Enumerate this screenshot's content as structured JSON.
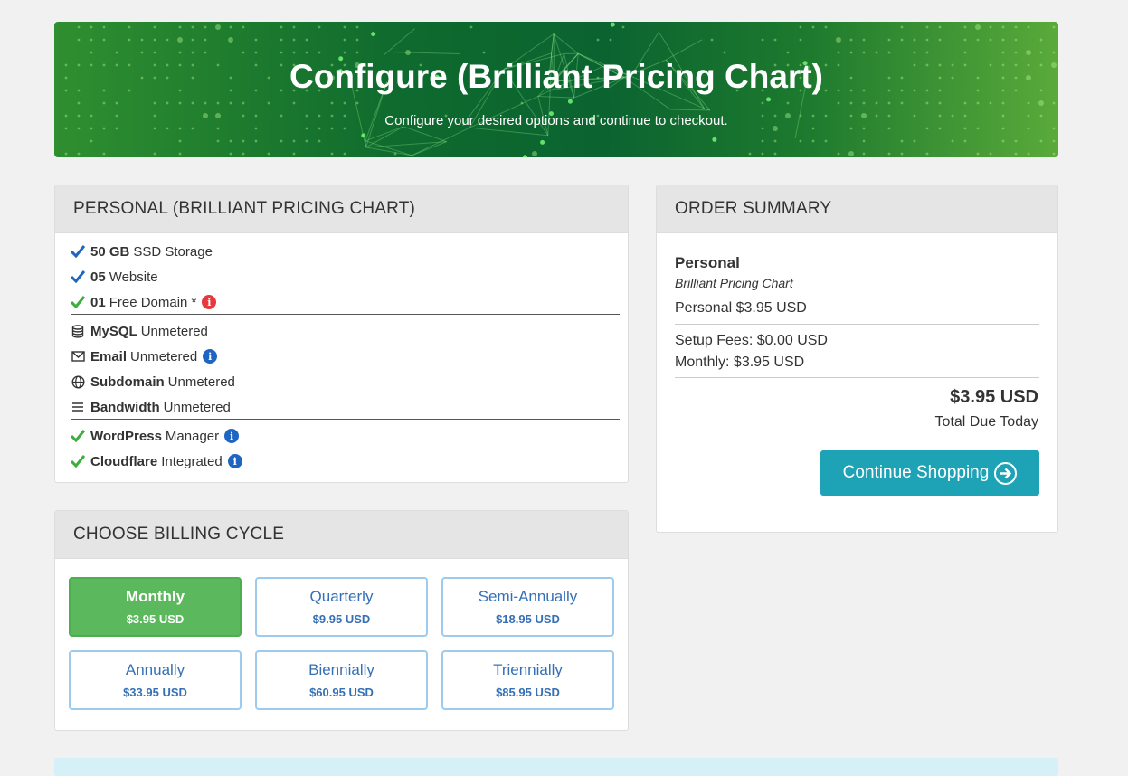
{
  "hero": {
    "title": "Configure (Brilliant Pricing Chart)",
    "subtitle": "Configure your desired options and continue to checkout."
  },
  "product_panel": {
    "title": "PERSONAL (BRILLIANT PRICING CHART)",
    "features": [
      {
        "bold": "50 GB",
        "text": "SSD Storage",
        "icon": "check-icon",
        "color": "#1e66c1"
      },
      {
        "bold": "05",
        "text": "Website",
        "icon": "check-icon",
        "color": "#1e66c1"
      },
      {
        "bold": "01",
        "text": "Free Domain *",
        "icon": "check-icon",
        "color": "#3cae3c",
        "info": "red-info-icon"
      },
      {
        "bold": "MySQL",
        "text": "Unmetered",
        "icon": "database-icon"
      },
      {
        "bold": "Email",
        "text": "Unmetered",
        "icon": "envelope-icon",
        "info": "info-icon"
      },
      {
        "bold": "Subdomain",
        "text": "Unmetered",
        "icon": "globe-icon"
      },
      {
        "bold": "Bandwidth",
        "text": "Unmetered",
        "icon": "bars-icon"
      },
      {
        "bold": "WordPress",
        "text": "Manager",
        "icon": "check-icon",
        "color": "#3cae3c",
        "info": "info-icon"
      },
      {
        "bold": "Cloudflare",
        "text": "Integrated",
        "icon": "check-icon",
        "color": "#3cae3c",
        "info": "info-icon"
      }
    ],
    "info_glyph": "i"
  },
  "billing": {
    "title": "CHOOSE BILLING CYCLE",
    "options": [
      {
        "label": "Monthly",
        "price": "$3.95 USD",
        "selected": true
      },
      {
        "label": "Quarterly",
        "price": "$9.95 USD"
      },
      {
        "label": "Semi-Annually",
        "price": "$18.95 USD"
      },
      {
        "label": "Annually",
        "price": "$33.95 USD"
      },
      {
        "label": "Biennially",
        "price": "$60.95 USD"
      },
      {
        "label": "Triennially",
        "price": "$85.95 USD"
      }
    ]
  },
  "summary": {
    "title": "ORDER SUMMARY",
    "product_name": "Personal",
    "product_group": "Brilliant Pricing Chart",
    "line_item": "Personal $3.95 USD",
    "setup_fees": "Setup Fees: $0.00 USD",
    "monthly": "Monthly: $3.95 USD",
    "total": "$3.95 USD",
    "total_label": "Total Due Today",
    "continue_label": "Continue Shopping"
  },
  "colors": {
    "accent": "#1ea2b5",
    "selected": "#5cb85c",
    "link": "#3570b6"
  }
}
